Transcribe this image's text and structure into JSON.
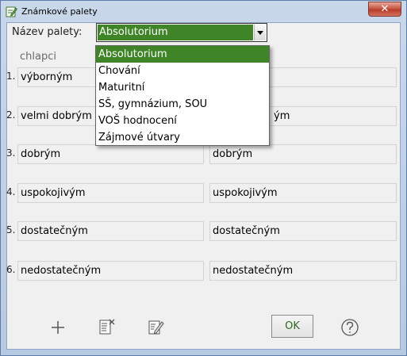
{
  "window": {
    "title": "Známkové palety",
    "close_label": "✕"
  },
  "palette_label": "Název palety:",
  "combo": {
    "selected": "Absolutorium"
  },
  "dropdown": {
    "items": [
      "Absolutorium",
      "Chování",
      "Maturitní",
      "SŠ, gymnázium, SOU",
      "VOŠ hodnocení",
      "Zájmové útvary"
    ]
  },
  "column_boys": "chlapci",
  "rows": [
    {
      "num": "1.",
      "boys": "výborným",
      "girls": ""
    },
    {
      "num": "2.",
      "boys": "velmi dobrým",
      "girls": "ým"
    },
    {
      "num": "3.",
      "boys": "dobrým",
      "girls": "dobrým"
    },
    {
      "num": "4.",
      "boys": "uspokojivým",
      "girls": "uspokojivým"
    },
    {
      "num": "5.",
      "boys": "dostatečným",
      "girls": "dostatečným"
    },
    {
      "num": "6.",
      "boys": "nedostatečným",
      "girls": "nedostatečným"
    }
  ],
  "buttons": {
    "ok": "OK",
    "add_icon": "plus-icon",
    "delete_icon": "delete-list-icon",
    "edit_icon": "edit-icon",
    "help_icon": "help-icon"
  },
  "colors": {
    "selection": "#3f8427"
  }
}
